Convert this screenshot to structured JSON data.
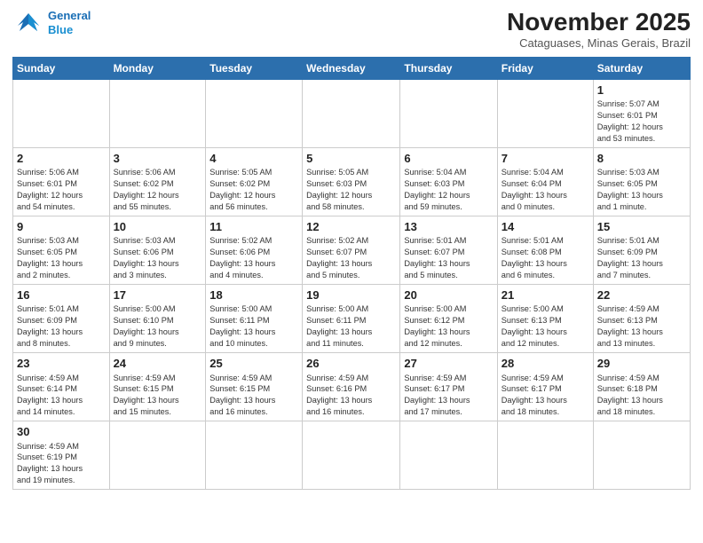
{
  "logo": {
    "line1": "General",
    "line2": "Blue"
  },
  "title": "November 2025",
  "subtitle": "Cataguases, Minas Gerais, Brazil",
  "days_of_week": [
    "Sunday",
    "Monday",
    "Tuesday",
    "Wednesday",
    "Thursday",
    "Friday",
    "Saturday"
  ],
  "weeks": [
    [
      {
        "num": "",
        "info": ""
      },
      {
        "num": "",
        "info": ""
      },
      {
        "num": "",
        "info": ""
      },
      {
        "num": "",
        "info": ""
      },
      {
        "num": "",
        "info": ""
      },
      {
        "num": "",
        "info": ""
      },
      {
        "num": "1",
        "info": "Sunrise: 5:07 AM\nSunset: 6:01 PM\nDaylight: 12 hours\nand 53 minutes."
      }
    ],
    [
      {
        "num": "2",
        "info": "Sunrise: 5:06 AM\nSunset: 6:01 PM\nDaylight: 12 hours\nand 54 minutes."
      },
      {
        "num": "3",
        "info": "Sunrise: 5:06 AM\nSunset: 6:02 PM\nDaylight: 12 hours\nand 55 minutes."
      },
      {
        "num": "4",
        "info": "Sunrise: 5:05 AM\nSunset: 6:02 PM\nDaylight: 12 hours\nand 56 minutes."
      },
      {
        "num": "5",
        "info": "Sunrise: 5:05 AM\nSunset: 6:03 PM\nDaylight: 12 hours\nand 58 minutes."
      },
      {
        "num": "6",
        "info": "Sunrise: 5:04 AM\nSunset: 6:03 PM\nDaylight: 12 hours\nand 59 minutes."
      },
      {
        "num": "7",
        "info": "Sunrise: 5:04 AM\nSunset: 6:04 PM\nDaylight: 13 hours\nand 0 minutes."
      },
      {
        "num": "8",
        "info": "Sunrise: 5:03 AM\nSunset: 6:05 PM\nDaylight: 13 hours\nand 1 minute."
      }
    ],
    [
      {
        "num": "9",
        "info": "Sunrise: 5:03 AM\nSunset: 6:05 PM\nDaylight: 13 hours\nand 2 minutes."
      },
      {
        "num": "10",
        "info": "Sunrise: 5:03 AM\nSunset: 6:06 PM\nDaylight: 13 hours\nand 3 minutes."
      },
      {
        "num": "11",
        "info": "Sunrise: 5:02 AM\nSunset: 6:06 PM\nDaylight: 13 hours\nand 4 minutes."
      },
      {
        "num": "12",
        "info": "Sunrise: 5:02 AM\nSunset: 6:07 PM\nDaylight: 13 hours\nand 5 minutes."
      },
      {
        "num": "13",
        "info": "Sunrise: 5:01 AM\nSunset: 6:07 PM\nDaylight: 13 hours\nand 5 minutes."
      },
      {
        "num": "14",
        "info": "Sunrise: 5:01 AM\nSunset: 6:08 PM\nDaylight: 13 hours\nand 6 minutes."
      },
      {
        "num": "15",
        "info": "Sunrise: 5:01 AM\nSunset: 6:09 PM\nDaylight: 13 hours\nand 7 minutes."
      }
    ],
    [
      {
        "num": "16",
        "info": "Sunrise: 5:01 AM\nSunset: 6:09 PM\nDaylight: 13 hours\nand 8 minutes."
      },
      {
        "num": "17",
        "info": "Sunrise: 5:00 AM\nSunset: 6:10 PM\nDaylight: 13 hours\nand 9 minutes."
      },
      {
        "num": "18",
        "info": "Sunrise: 5:00 AM\nSunset: 6:11 PM\nDaylight: 13 hours\nand 10 minutes."
      },
      {
        "num": "19",
        "info": "Sunrise: 5:00 AM\nSunset: 6:11 PM\nDaylight: 13 hours\nand 11 minutes."
      },
      {
        "num": "20",
        "info": "Sunrise: 5:00 AM\nSunset: 6:12 PM\nDaylight: 13 hours\nand 12 minutes."
      },
      {
        "num": "21",
        "info": "Sunrise: 5:00 AM\nSunset: 6:13 PM\nDaylight: 13 hours\nand 12 minutes."
      },
      {
        "num": "22",
        "info": "Sunrise: 4:59 AM\nSunset: 6:13 PM\nDaylight: 13 hours\nand 13 minutes."
      }
    ],
    [
      {
        "num": "23",
        "info": "Sunrise: 4:59 AM\nSunset: 6:14 PM\nDaylight: 13 hours\nand 14 minutes."
      },
      {
        "num": "24",
        "info": "Sunrise: 4:59 AM\nSunset: 6:15 PM\nDaylight: 13 hours\nand 15 minutes."
      },
      {
        "num": "25",
        "info": "Sunrise: 4:59 AM\nSunset: 6:15 PM\nDaylight: 13 hours\nand 16 minutes."
      },
      {
        "num": "26",
        "info": "Sunrise: 4:59 AM\nSunset: 6:16 PM\nDaylight: 13 hours\nand 16 minutes."
      },
      {
        "num": "27",
        "info": "Sunrise: 4:59 AM\nSunset: 6:17 PM\nDaylight: 13 hours\nand 17 minutes."
      },
      {
        "num": "28",
        "info": "Sunrise: 4:59 AM\nSunset: 6:17 PM\nDaylight: 13 hours\nand 18 minutes."
      },
      {
        "num": "29",
        "info": "Sunrise: 4:59 AM\nSunset: 6:18 PM\nDaylight: 13 hours\nand 18 minutes."
      }
    ],
    [
      {
        "num": "30",
        "info": "Sunrise: 4:59 AM\nSunset: 6:19 PM\nDaylight: 13 hours\nand 19 minutes."
      },
      {
        "num": "",
        "info": ""
      },
      {
        "num": "",
        "info": ""
      },
      {
        "num": "",
        "info": ""
      },
      {
        "num": "",
        "info": ""
      },
      {
        "num": "",
        "info": ""
      },
      {
        "num": "",
        "info": ""
      }
    ]
  ]
}
